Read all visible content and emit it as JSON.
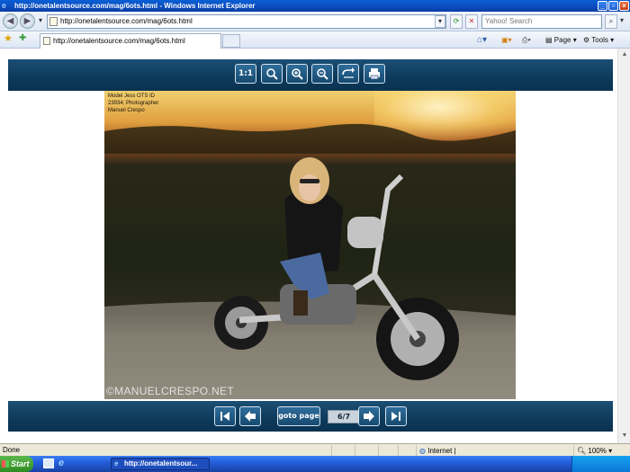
{
  "window": {
    "title": "http://onetalentsource.com/mag/6ots.html - Windows Internet Explorer"
  },
  "addressbar": {
    "url": "http://onetalentsource.com/mag/6ots.html",
    "search_placeholder": "Yahoo! Search"
  },
  "tab": {
    "label": "http://onetalentsource.com/mag/6ots.html"
  },
  "commandbar": {
    "page_label": "Page",
    "tools_label": "Tools"
  },
  "viewer": {
    "toolbar": {
      "actual_size_label": "1:1"
    },
    "photo": {
      "caption_lines": [
        "Model Jess OTS ID",
        "23934; Photographer",
        "Manuel Crespo"
      ],
      "watermark": "©MANUELCRESPO.NET"
    },
    "nav": {
      "goto_label": "goto page",
      "page_indicator": "6/7"
    }
  },
  "statusbar": {
    "status_text": "Done",
    "zone_text": "Internet |",
    "zoom_text": "100%"
  },
  "taskbar": {
    "start_label": "Start",
    "task_label": "http://onetalentsour..."
  },
  "colors": {
    "viewer_bar": "#0d3a5a",
    "title_bar": "#0a4fc0",
    "taskbar": "#245edb"
  }
}
